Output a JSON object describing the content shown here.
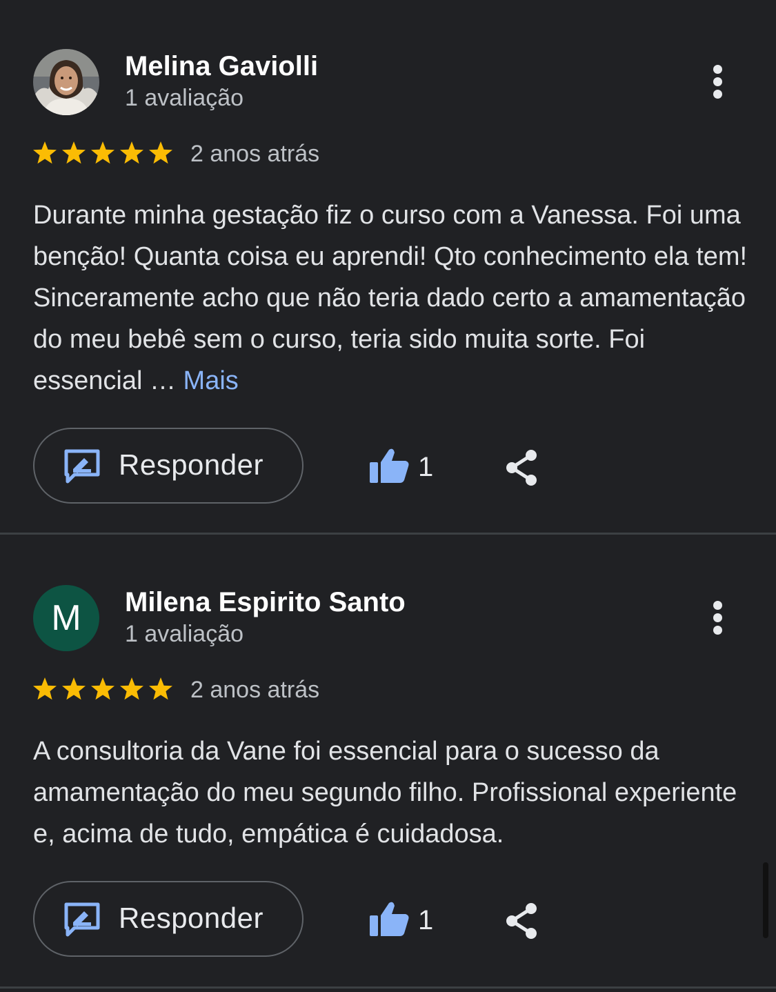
{
  "reviews": [
    {
      "name": "Melina Gaviolli",
      "review_count": "1 avaliação",
      "avatar": "photo",
      "rating": 5,
      "time": "2 anos atrás",
      "text": "Durante minha gestação fiz o curso com a Vanessa. Foi uma benção! Quanta coisa eu aprendi! Qto conhecimento ela tem! Sinceramente acho que não teria dado certo a amamentação do meu bebê sem o curso, teria sido muita sorte. Foi essencial … ",
      "more_label": "Mais",
      "reply_label": "Responder",
      "likes": "1"
    },
    {
      "name": "Milena Espirito Santo",
      "review_count": "1 avaliação",
      "avatar_letter": "M",
      "rating": 5,
      "time": "2 anos atrás",
      "text": "A consultoria da Vane foi essencial para o sucesso da amamentação do meu segundo filho. Profissional experiente e, acima de tudo, empática é cuidadosa.",
      "reply_label": "Responder",
      "likes": "1"
    }
  ],
  "icons": {
    "more": "more-vert-icon",
    "star": "star-icon",
    "reply": "reply-icon",
    "like": "thumb-up-icon",
    "share": "share-icon"
  },
  "colors": {
    "background": "#202124",
    "star": "#fbbc04",
    "link": "#8ab4f8",
    "like": "#8ab4f8",
    "avatar_letter_bg": "#0d5443"
  }
}
